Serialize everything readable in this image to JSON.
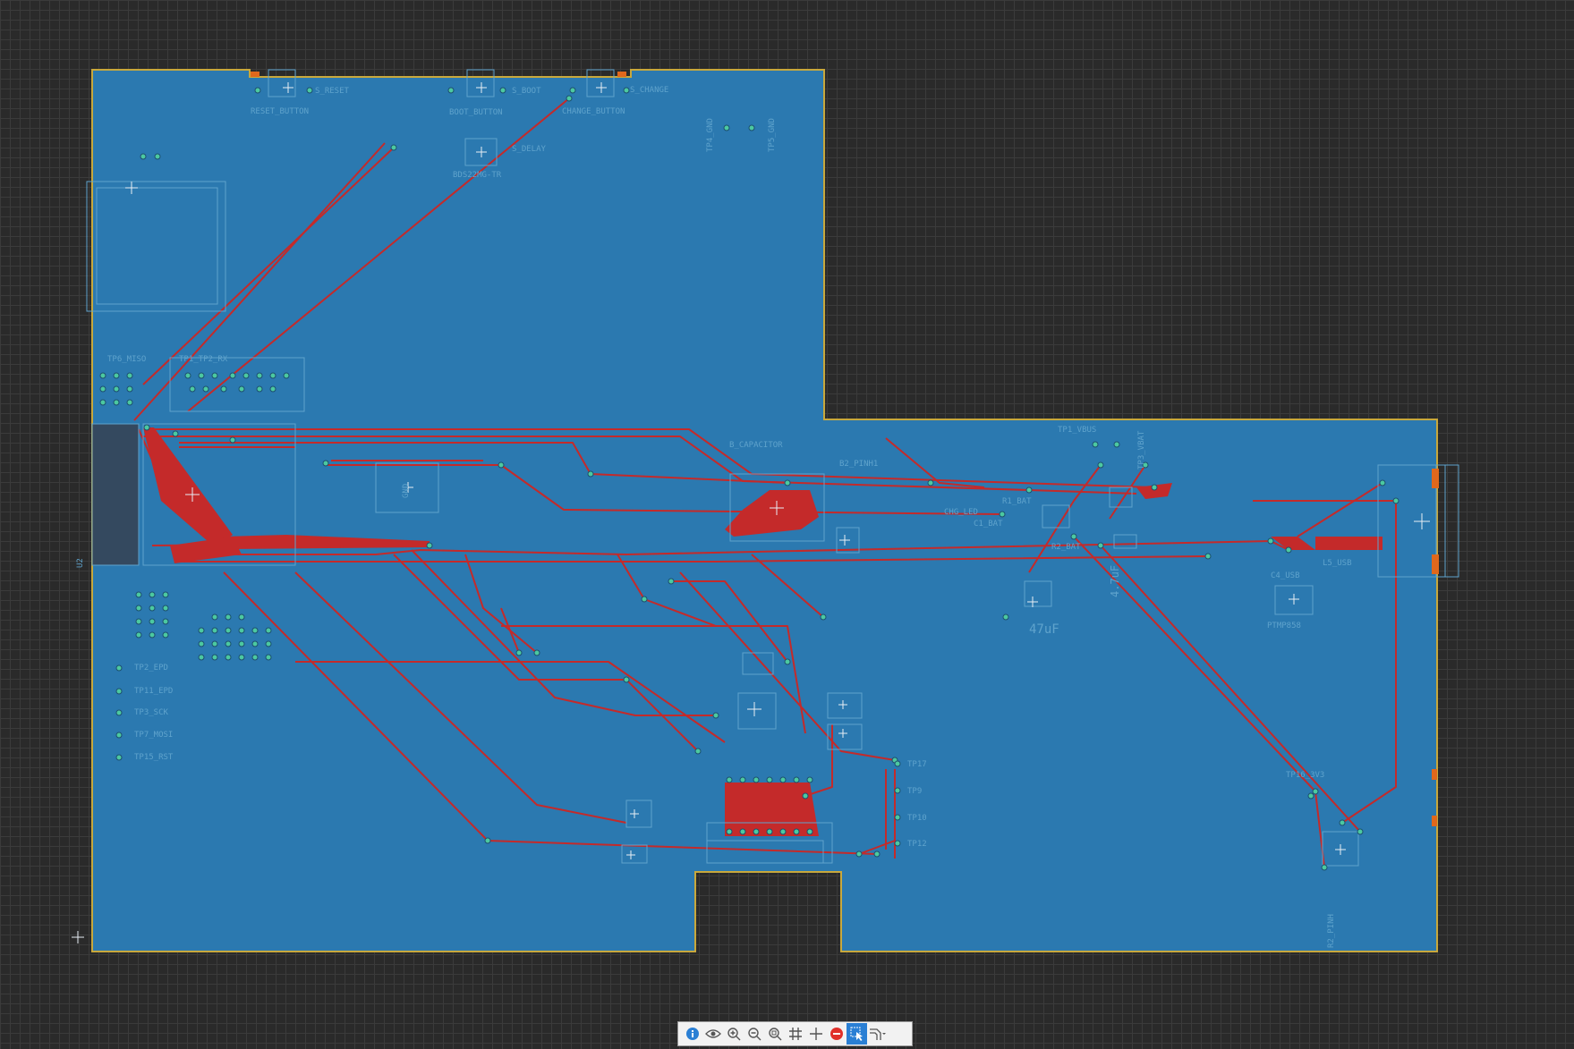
{
  "board": {
    "colors": {
      "background": "#2a2a2a",
      "board_fill": "#2b79b0",
      "outline": "#c8a83c",
      "trace": "#c42a2a",
      "silkscreen": "#5fa3cc",
      "via": "#4cc9a0"
    },
    "labels": {
      "u2": "U2",
      "reset_button": "RESET_BUTTON",
      "s_reset": "S_RESET",
      "boot_button": "BOOT_BUTTON",
      "s_boot": "S_BOOT",
      "change_button": "CHANGE_BUTTON",
      "s_change": "S_CHANGE",
      "s_delay": "S_DELAY",
      "bds": "BDS22MG-TR",
      "tp4_gnd": "TP4_GND",
      "tp5_gnd": "TP5_GND",
      "tp6_miso": "TP6_MISO",
      "tp1_tp2_rx": "TP1_TP2_RX",
      "b_capacitor": "B_CAPACITOR",
      "b2_pinh1": "B2_PINH1",
      "tp1_vbus": "TP1_VBUS",
      "tp3_vbat": "TP3_VBAT",
      "r1_bat": "R1_BAT",
      "r2_bat": "R2_BAT",
      "chg_led": "CHG_LED",
      "c1_bat": "C1_BAT",
      "l5_usb": "L5_USB",
      "c4_usb": "C4_USB",
      "ptmp": "PTMP858",
      "c47uf": "47uF",
      "c47uf_2": "4.7uF",
      "tp2_epd": "TP2_EPD",
      "tp11_epd": "TP11_EPD",
      "tp3_sck": "TP3_SCK",
      "tp7_mosi": "TP7_MOSI",
      "tp15_rst": "TP15_RST",
      "tp17": "TP17",
      "tp9": "TP9",
      "tp10": "TP10",
      "tp12": "TP12",
      "tp16_3v3": "TP16_3V3",
      "gnd": "GND",
      "r2_pinh": "R2_PINH"
    }
  },
  "toolbar": {
    "buttons": [
      {
        "name": "info-icon",
        "active": false
      },
      {
        "name": "eye-icon",
        "active": false
      },
      {
        "name": "zoom-in-icon",
        "active": false
      },
      {
        "name": "zoom-out-icon",
        "active": false
      },
      {
        "name": "zoom-fit-icon",
        "active": false
      },
      {
        "name": "grid-icon",
        "active": false
      },
      {
        "name": "crosshair-icon",
        "active": false
      },
      {
        "name": "stop-icon",
        "active": false
      },
      {
        "name": "select-icon",
        "active": true
      },
      {
        "name": "route-icon",
        "active": false
      }
    ]
  }
}
